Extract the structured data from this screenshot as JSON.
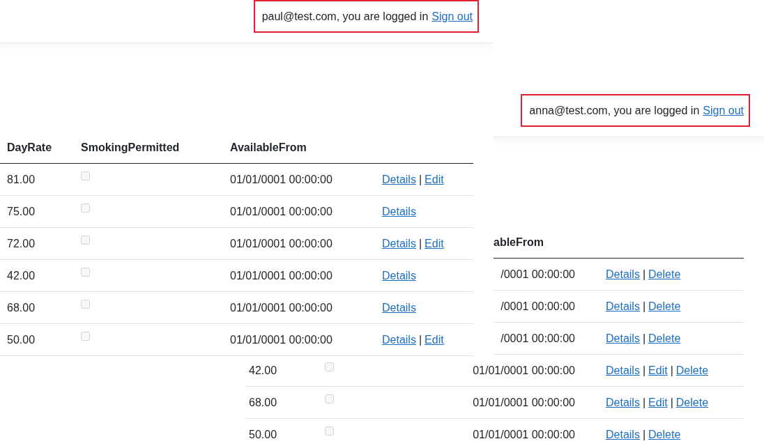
{
  "windows": [
    {
      "login": {
        "message": "paul@test.com, you are logged in",
        "link": "Sign out"
      },
      "table": {
        "columns": {
          "day_rate": "DayRate",
          "smoking_permitted": "SmokingPermitted",
          "available_from": "AvailableFrom"
        },
        "rows": [
          {
            "day_rate": "81.00",
            "smoking_permitted": {
              "checked": false
            },
            "available_from": "01/01/0001 00:00:00",
            "actions": [
              {
                "kind": "link",
                "text": "Details"
              },
              {
                "kind": "separator",
                "text": "|"
              },
              {
                "kind": "link",
                "text": "Edit"
              }
            ]
          },
          {
            "day_rate": "75.00",
            "smoking_permitted": {
              "checked": false
            },
            "available_from": "01/01/0001 00:00:00",
            "actions": [
              {
                "kind": "link",
                "text": "Details"
              }
            ]
          },
          {
            "day_rate": "72.00",
            "smoking_permitted": {
              "checked": false
            },
            "available_from": "01/01/0001 00:00:00",
            "actions": [
              {
                "kind": "link",
                "text": "Details"
              },
              {
                "kind": "separator",
                "text": "|"
              },
              {
                "kind": "link",
                "text": "Edit"
              }
            ]
          },
          {
            "day_rate": "42.00",
            "smoking_permitted": {
              "checked": false
            },
            "available_from": "01/01/0001 00:00:00",
            "actions": [
              {
                "kind": "link",
                "text": "Details"
              }
            ]
          },
          {
            "day_rate": "68.00",
            "smoking_permitted": {
              "checked": false
            },
            "available_from": "01/01/0001 00:00:00",
            "actions": [
              {
                "kind": "link",
                "text": "Details"
              }
            ]
          },
          {
            "day_rate": "50.00",
            "smoking_permitted": {
              "checked": false
            },
            "available_from": "01/01/0001 00:00:00",
            "actions": [
              {
                "kind": "link",
                "text": "Details"
              },
              {
                "kind": "separator",
                "text": "|"
              },
              {
                "kind": "link",
                "text": "Edit"
              }
            ]
          }
        ]
      }
    },
    {
      "login": {
        "message": "anna@test.com, you are logged in",
        "link": "Sign out"
      },
      "table": {
        "columns": {
          "available_from": "ableFrom"
        },
        "rows": [
          {
            "available_from": "/0001 00:00:00",
            "actions": [
              {
                "kind": "link",
                "text": "Details"
              },
              {
                "kind": "separator",
                "text": "|"
              },
              {
                "kind": "link",
                "text": "Delete"
              }
            ]
          },
          {
            "available_from": "/0001 00:00:00",
            "actions": [
              {
                "kind": "link",
                "text": "Details"
              },
              {
                "kind": "separator",
                "text": "|"
              },
              {
                "kind": "link",
                "text": "Delete"
              }
            ]
          },
          {
            "available_from": "/0001 00:00:00",
            "actions": [
              {
                "kind": "link",
                "text": "Details"
              },
              {
                "kind": "separator",
                "text": "|"
              },
              {
                "kind": "link",
                "text": "Delete"
              }
            ]
          },
          {
            "day_rate": "42.00",
            "smoking_permitted": {
              "checked": false
            },
            "available_from": "01/01/0001 00:00:00",
            "actions": [
              {
                "kind": "link",
                "text": "Details"
              },
              {
                "kind": "separator",
                "text": "|"
              },
              {
                "kind": "link",
                "text": "Edit"
              },
              {
                "kind": "separator",
                "text": "|"
              },
              {
                "kind": "link",
                "text": "Delete"
              }
            ]
          },
          {
            "day_rate": "68.00",
            "smoking_permitted": {
              "checked": false
            },
            "available_from": "01/01/0001 00:00:00",
            "actions": [
              {
                "kind": "link",
                "text": "Details"
              },
              {
                "kind": "separator",
                "text": "|"
              },
              {
                "kind": "link",
                "text": "Edit"
              },
              {
                "kind": "separator",
                "text": "|"
              },
              {
                "kind": "link",
                "text": "Delete"
              }
            ]
          },
          {
            "day_rate": "50.00",
            "smoking_permitted": {
              "checked": false
            },
            "available_from": "01/01/0001 00:00:00",
            "actions": [
              {
                "kind": "link",
                "text": "Details"
              },
              {
                "kind": "separator",
                "text": "|"
              },
              {
                "kind": "link",
                "text": "Delete"
              }
            ]
          }
        ]
      }
    }
  ]
}
